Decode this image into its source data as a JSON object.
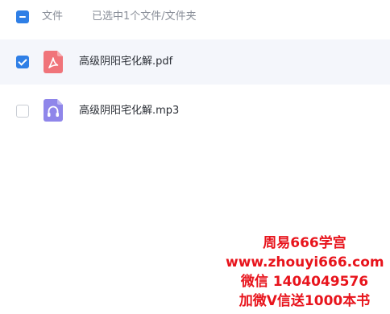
{
  "header": {
    "column_name": "文件",
    "selection_status": "已选中1个文件/文件夹"
  },
  "files": [
    {
      "name": "高级阴阳宅化解.pdf",
      "type": "pdf",
      "selected": true
    },
    {
      "name": "高级阴阳宅化解.mp3",
      "type": "mp3",
      "selected": false
    }
  ],
  "watermark": {
    "line1": "周易666学宫",
    "line2": "www.zhouyi666.com",
    "line3": "微信 1404049576",
    "line4": "加微V信送1000本书"
  },
  "colors": {
    "accent": "#2f7fe6",
    "pdf_icon": "#f0747a",
    "audio_icon": "#8f86ea",
    "watermark": "#e8141c"
  }
}
